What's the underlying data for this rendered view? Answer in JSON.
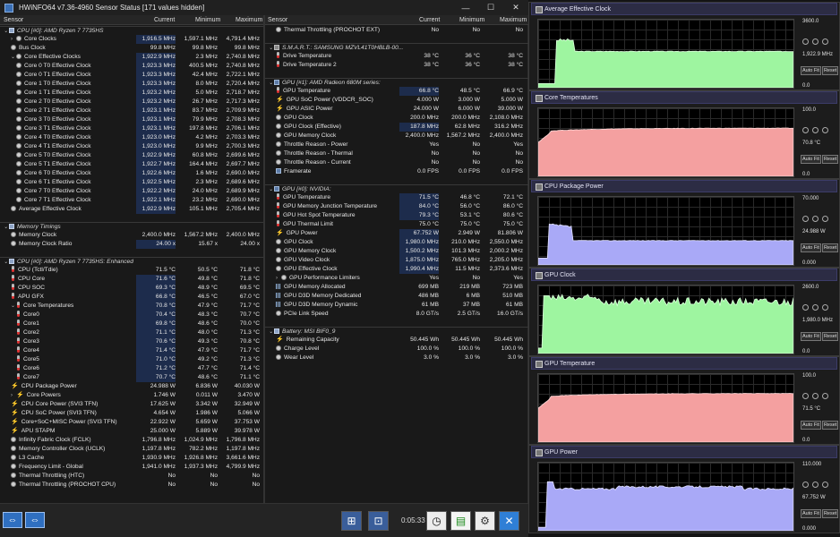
{
  "window": {
    "title": "HWiNFO64 v7.36-4960 Sensor Status [171 values hidden]",
    "min": "—",
    "max": "☐",
    "close": "✕"
  },
  "columns": {
    "sensor": "Sensor",
    "current": "Current",
    "minimum": "Minimum",
    "maximum": "Maximum"
  },
  "left_rows": [
    {
      "t": "g",
      "n": "CPU [#0]: AMD Ryzen 7 7735HS",
      "i": "chip",
      "e": "⌄"
    },
    {
      "n": "Core Clocks",
      "c": "1,916.5 MHz",
      "mi": "1,597.1 MHz",
      "ma": "4,791.4 MHz",
      "i": "circle",
      "e": "›",
      "d": 1,
      "h": 1
    },
    {
      "n": "Bus Clock",
      "c": "99.8 MHz",
      "mi": "99.8 MHz",
      "ma": "99.8 MHz",
      "i": "circle",
      "d": 1
    },
    {
      "n": "Core Effective Clocks",
      "c": "1,922.9 MHz",
      "mi": "2.3 MHz",
      "ma": "2,740.8 MHz",
      "i": "circle",
      "e": "⌄",
      "d": 1,
      "h": 1
    },
    {
      "n": "Core 0 T0 Effective Clock",
      "c": "1,923.3 MHz",
      "mi": "400.5 MHz",
      "ma": "2,740.8 MHz",
      "i": "circle",
      "d": 2,
      "h": 1
    },
    {
      "n": "Core 0 T1 Effective Clock",
      "c": "1,923.3 MHz",
      "mi": "42.4 MHz",
      "ma": "2,722.1 MHz",
      "i": "circle",
      "d": 2,
      "h": 1
    },
    {
      "n": "Core 1 T0 Effective Clock",
      "c": "1,923.3 MHz",
      "mi": "8.0 MHz",
      "ma": "2,720.4 MHz",
      "i": "circle",
      "d": 2,
      "h": 1
    },
    {
      "n": "Core 1 T1 Effective Clock",
      "c": "1,923.2 MHz",
      "mi": "5.0 MHz",
      "ma": "2,718.7 MHz",
      "i": "circle",
      "d": 2,
      "h": 1
    },
    {
      "n": "Core 2 T0 Effective Clock",
      "c": "1,923.2 MHz",
      "mi": "26.7 MHz",
      "ma": "2,717.3 MHz",
      "i": "circle",
      "d": 2,
      "h": 1
    },
    {
      "n": "Core 2 T1 Effective Clock",
      "c": "1,923.1 MHz",
      "mi": "83.7 MHz",
      "ma": "2,709.9 MHz",
      "i": "circle",
      "d": 2,
      "h": 1
    },
    {
      "n": "Core 3 T0 Effective Clock",
      "c": "1,923.1 MHz",
      "mi": "79.9 MHz",
      "ma": "2,708.3 MHz",
      "i": "circle",
      "d": 2,
      "h": 1
    },
    {
      "n": "Core 3 T1 Effective Clock",
      "c": "1,923.1 MHz",
      "mi": "197.8 MHz",
      "ma": "2,706.1 MHz",
      "i": "circle",
      "d": 2,
      "h": 1
    },
    {
      "n": "Core 4 T0 Effective Clock",
      "c": "1,923.0 MHz",
      "mi": "4.2 MHz",
      "ma": "2,703.3 MHz",
      "i": "circle",
      "d": 2,
      "h": 1
    },
    {
      "n": "Core 4 T1 Effective Clock",
      "c": "1,923.0 MHz",
      "mi": "9.9 MHz",
      "ma": "2,700.3 MHz",
      "i": "circle",
      "d": 2,
      "h": 1
    },
    {
      "n": "Core 5 T0 Effective Clock",
      "c": "1,922.9 MHz",
      "mi": "60.8 MHz",
      "ma": "2,699.6 MHz",
      "i": "circle",
      "d": 2,
      "h": 1
    },
    {
      "n": "Core 5 T1 Effective Clock",
      "c": "1,922.7 MHz",
      "mi": "164.4 MHz",
      "ma": "2,697.7 MHz",
      "i": "circle",
      "d": 2,
      "h": 1
    },
    {
      "n": "Core 6 T0 Effective Clock",
      "c": "1,922.6 MHz",
      "mi": "1.6 MHz",
      "ma": "2,690.0 MHz",
      "i": "circle",
      "d": 2,
      "h": 1
    },
    {
      "n": "Core 6 T1 Effective Clock",
      "c": "1,922.5 MHz",
      "mi": "2.3 MHz",
      "ma": "2,689.6 MHz",
      "i": "circle",
      "d": 2,
      "h": 1
    },
    {
      "n": "Core 7 T0 Effective Clock",
      "c": "1,922.2 MHz",
      "mi": "24.0 MHz",
      "ma": "2,689.9 MHz",
      "i": "circle",
      "d": 2,
      "h": 1
    },
    {
      "n": "Core 7 T1 Effective Clock",
      "c": "1,922.1 MHz",
      "mi": "23.2 MHz",
      "ma": "2,690.0 MHz",
      "i": "circle",
      "d": 2,
      "h": 1
    },
    {
      "n": "Average Effective Clock",
      "c": "1,922.9 MHz",
      "mi": "105.1 MHz",
      "ma": "2,705.4 MHz",
      "i": "circle",
      "d": 1,
      "h": 1
    },
    {
      "t": "s"
    },
    {
      "t": "g",
      "n": "Memory Timings",
      "i": "chip",
      "e": "⌄"
    },
    {
      "n": "Memory Clock",
      "c": "2,400.0 MHz",
      "mi": "1,567.2 MHz",
      "ma": "2,400.0 MHz",
      "i": "circle",
      "d": 1
    },
    {
      "n": "Memory Clock Ratio",
      "c": "24.00 x",
      "mi": "15.67 x",
      "ma": "24.00 x",
      "i": "circle",
      "d": 1,
      "h": 1
    },
    {
      "t": "s"
    },
    {
      "t": "g",
      "n": "CPU [#0]: AMD Ryzen 7 7735HS: Enhanced",
      "i": "chip",
      "e": "⌄"
    },
    {
      "n": "CPU (Tctl/Tdie)",
      "c": "71.5 °C",
      "mi": "50.5 °C",
      "ma": "71.8 °C",
      "i": "therm",
      "d": 1
    },
    {
      "n": "CPU Core",
      "c": "71.6 °C",
      "mi": "49.8 °C",
      "ma": "71.8 °C",
      "i": "therm",
      "d": 1,
      "h": 1
    },
    {
      "n": "CPU SOC",
      "c": "69.3 °C",
      "mi": "48.9 °C",
      "ma": "69.5 °C",
      "i": "therm",
      "d": 1,
      "h": 1
    },
    {
      "n": "APU GFX",
      "c": "66.8 °C",
      "mi": "46.5 °C",
      "ma": "67.0 °C",
      "i": "therm",
      "d": 1,
      "h": 1
    },
    {
      "n": "Core Temperatures",
      "c": "70.8 °C",
      "mi": "47.9 °C",
      "ma": "71.7 °C",
      "i": "therm",
      "e": "⌄",
      "d": 1,
      "h": 1
    },
    {
      "n": "Core0",
      "c": "70.4 °C",
      "mi": "48.3 °C",
      "ma": "70.7 °C",
      "i": "therm",
      "d": 2,
      "h": 1
    },
    {
      "n": "Core1",
      "c": "69.8 °C",
      "mi": "48.6 °C",
      "ma": "70.0 °C",
      "i": "therm",
      "d": 2,
      "h": 1
    },
    {
      "n": "Core2",
      "c": "71.1 °C",
      "mi": "48.0 °C",
      "ma": "71.3 °C",
      "i": "therm",
      "d": 2,
      "h": 1
    },
    {
      "n": "Core3",
      "c": "70.6 °C",
      "mi": "49.3 °C",
      "ma": "70.8 °C",
      "i": "therm",
      "d": 2,
      "h": 1
    },
    {
      "n": "Core4",
      "c": "71.4 °C",
      "mi": "47.9 °C",
      "ma": "71.7 °C",
      "i": "therm",
      "d": 2,
      "h": 1
    },
    {
      "n": "Core5",
      "c": "71.0 °C",
      "mi": "49.2 °C",
      "ma": "71.3 °C",
      "i": "therm",
      "d": 2,
      "h": 1
    },
    {
      "n": "Core6",
      "c": "71.2 °C",
      "mi": "47.7 °C",
      "ma": "71.4 °C",
      "i": "therm",
      "d": 2,
      "h": 1
    },
    {
      "n": "Core7",
      "c": "70.7 °C",
      "mi": "48.6 °C",
      "ma": "71.1 °C",
      "i": "therm",
      "d": 2,
      "h": 1
    },
    {
      "n": "CPU Package Power",
      "c": "24.988 W",
      "mi": "6.836 W",
      "ma": "40.030 W",
      "i": "bolt",
      "d": 1
    },
    {
      "n": "Core Powers",
      "c": "1.746 W",
      "mi": "0.011 W",
      "ma": "3.470 W",
      "i": "bolt",
      "e": "›",
      "d": 1
    },
    {
      "n": "CPU Core Power (SVI3 TFN)",
      "c": "17.625 W",
      "mi": "3.342 W",
      "ma": "32.949 W",
      "i": "bolt",
      "d": 1
    },
    {
      "n": "CPU SoC Power (SVI3 TFN)",
      "c": "4.654 W",
      "mi": "1.986 W",
      "ma": "5.066 W",
      "i": "bolt",
      "d": 1
    },
    {
      "n": "Core+SoC+MISC Power (SVI3 TFN)",
      "c": "22.922 W",
      "mi": "5.659 W",
      "ma": "37.753 W",
      "i": "bolt",
      "d": 1
    },
    {
      "n": "APU STAPM",
      "c": "25.000 W",
      "mi": "5.889 W",
      "ma": "39.978 W",
      "i": "bolt",
      "d": 1
    },
    {
      "n": "Infinity Fabric Clock (FCLK)",
      "c": "1,796.8 MHz",
      "mi": "1,024.9 MHz",
      "ma": "1,796.8 MHz",
      "i": "circle",
      "d": 1
    },
    {
      "n": "Memory Controller Clock (UCLK)",
      "c": "1,197.8 MHz",
      "mi": "782.2 MHz",
      "ma": "1,197.8 MHz",
      "i": "circle",
      "d": 1
    },
    {
      "n": "L3 Cache",
      "c": "1,930.9 MHz",
      "mi": "1,926.8 MHz",
      "ma": "3,661.6 MHz",
      "i": "circle",
      "d": 1
    },
    {
      "n": "Frequency Limit - Global",
      "c": "1,941.0 MHz",
      "mi": "1,937.3 MHz",
      "ma": "4,799.9 MHz",
      "i": "circle",
      "d": 1
    },
    {
      "n": "Thermal Throttling (HTC)",
      "c": "No",
      "mi": "No",
      "ma": "No",
      "i": "circle",
      "d": 1
    },
    {
      "n": "Thermal Throttling (PROCHOT CPU)",
      "c": "No",
      "mi": "No",
      "ma": "No",
      "i": "circle",
      "d": 1
    }
  ],
  "right_rows": [
    {
      "n": "Thermal Throttling (PROCHOT EXT)",
      "c": "No",
      "mi": "No",
      "ma": "No",
      "i": "circle",
      "d": 1
    },
    {
      "t": "s"
    },
    {
      "t": "g",
      "n": "S.M.A.R.T.: SAMSUNG MZVL41T0HBLB-00...",
      "i": "hdd",
      "e": "⌄"
    },
    {
      "n": "Drive Temperature",
      "c": "38 °C",
      "mi": "36 °C",
      "ma": "38 °C",
      "i": "therm",
      "d": 1
    },
    {
      "n": "Drive Temperature 2",
      "c": "38 °C",
      "mi": "36 °C",
      "ma": "38 °C",
      "i": "therm",
      "d": 1
    },
    {
      "t": "s"
    },
    {
      "t": "g",
      "n": "GPU [#1]: AMD Radeon 680M series:",
      "i": "mon",
      "e": "⌄"
    },
    {
      "n": "GPU Temperature",
      "c": "66.8 °C",
      "mi": "48.5 °C",
      "ma": "66.9 °C",
      "i": "therm",
      "d": 1,
      "h": 1
    },
    {
      "n": "GPU SoC Power (VDDCR_SOC)",
      "c": "4.000 W",
      "mi": "3.000 W",
      "ma": "5.000 W",
      "i": "bolt",
      "d": 1
    },
    {
      "n": "GPU ASIC Power",
      "c": "24.000 W",
      "mi": "6.000 W",
      "ma": "39.000 W",
      "i": "bolt",
      "d": 1
    },
    {
      "n": "GPU Clock",
      "c": "200.0 MHz",
      "mi": "200.0 MHz",
      "ma": "2,108.0 MHz",
      "i": "circle",
      "d": 1
    },
    {
      "n": "GPU Clock (Effective)",
      "c": "187.8 MHz",
      "mi": "62.8 MHz",
      "ma": "316.2 MHz",
      "i": "circle",
      "d": 1,
      "h": 1
    },
    {
      "n": "GPU Memory Clock",
      "c": "2,400.0 MHz",
      "mi": "1,567.2 MHz",
      "ma": "2,400.0 MHz",
      "i": "circle",
      "d": 1
    },
    {
      "n": "Throttle Reason - Power",
      "c": "Yes",
      "mi": "No",
      "ma": "Yes",
      "i": "circle",
      "d": 1
    },
    {
      "n": "Throttle Reason - Thermal",
      "c": "No",
      "mi": "No",
      "ma": "No",
      "i": "circle",
      "d": 1
    },
    {
      "n": "Throttle Reason - Current",
      "c": "No",
      "mi": "No",
      "ma": "No",
      "i": "circle",
      "d": 1
    },
    {
      "n": "Framerate",
      "c": "0.0 FPS",
      "mi": "0.0 FPS",
      "ma": "0.0 FPS",
      "i": "mon",
      "d": 1
    },
    {
      "t": "s"
    },
    {
      "t": "g",
      "n": "GPU [#0]: NVIDIA:",
      "i": "mon",
      "e": "⌄"
    },
    {
      "n": "GPU Temperature",
      "c": "71.5 °C",
      "mi": "46.8 °C",
      "ma": "72.1 °C",
      "i": "therm",
      "d": 1,
      "h": 1
    },
    {
      "n": "GPU Memory Junction Temperature",
      "c": "84.0 °C",
      "mi": "56.0 °C",
      "ma": "86.0 °C",
      "i": "therm",
      "d": 1,
      "h": 1
    },
    {
      "n": "GPU Hot Spot Temperature",
      "c": "79.3 °C",
      "mi": "53.1 °C",
      "ma": "80.6 °C",
      "i": "therm",
      "d": 1,
      "h": 1
    },
    {
      "n": "GPU Thermal Limit",
      "c": "75.0 °C",
      "mi": "75.0 °C",
      "ma": "75.0 °C",
      "i": "therm",
      "d": 1
    },
    {
      "n": "GPU Power",
      "c": "67.752 W",
      "mi": "2.949 W",
      "ma": "81.806 W",
      "i": "bolt",
      "d": 1,
      "h": 1
    },
    {
      "n": "GPU Clock",
      "c": "1,980.0 MHz",
      "mi": "210.0 MHz",
      "ma": "2,550.0 MHz",
      "i": "circle",
      "d": 1,
      "h": 1
    },
    {
      "n": "GPU Memory Clock",
      "c": "1,500.2 MHz",
      "mi": "101.3 MHz",
      "ma": "2,000.2 MHz",
      "i": "circle",
      "d": 1,
      "h": 1
    },
    {
      "n": "GPU Video Clock",
      "c": "1,875.0 MHz",
      "mi": "765.0 MHz",
      "ma": "2,205.0 MHz",
      "i": "circle",
      "d": 1,
      "h": 1
    },
    {
      "n": "GPU Effective Clock",
      "c": "1,990.4 MHz",
      "mi": "11.5 MHz",
      "ma": "2,373.6 MHz",
      "i": "circle",
      "d": 1,
      "h": 1
    },
    {
      "n": "GPU Performance Limiters",
      "c": "Yes",
      "mi": "No",
      "ma": "Yes",
      "i": "circle",
      "e": "›",
      "d": 1
    },
    {
      "n": "GPU Memory Allocated",
      "c": "699 MB",
      "mi": "219 MB",
      "ma": "723 MB",
      "i": "bar",
      "d": 1
    },
    {
      "n": "GPU D3D Memory Dedicated",
      "c": "486 MB",
      "mi": "6 MB",
      "ma": "510 MB",
      "i": "bar",
      "d": 1
    },
    {
      "n": "GPU D3D Memory Dynamic",
      "c": "61 MB",
      "mi": "37 MB",
      "ma": "61 MB",
      "i": "bar",
      "d": 1
    },
    {
      "n": "PCIe Link Speed",
      "c": "8.0 GT/s",
      "mi": "2.5 GT/s",
      "ma": "16.0 GT/s",
      "i": "circle",
      "d": 1
    },
    {
      "t": "s"
    },
    {
      "t": "g",
      "n": "Battery: MSI BIF0_9",
      "i": "chip",
      "e": "⌄"
    },
    {
      "n": "Remaining Capacity",
      "c": "50.445 Wh",
      "mi": "50.445 Wh",
      "ma": "50.445 Wh",
      "i": "bolt",
      "d": 1
    },
    {
      "n": "Charge Level",
      "c": "100.0 %",
      "mi": "100.0 %",
      "ma": "100.0 %",
      "i": "circle",
      "d": 1
    },
    {
      "n": "Wear Level",
      "c": "3.0 %",
      "mi": "3.0 %",
      "ma": "3.0 %",
      "i": "circle",
      "d": 1
    }
  ],
  "bottom": {
    "timer": "0:05:33",
    "nav_left": "⇔",
    "nav_right": "⇔",
    "btn_net": "⊞",
    "btn_mon": "⊡",
    "btn_clock": "◷",
    "btn_report": "▤",
    "btn_settings": "⚙",
    "btn_close": "✕"
  },
  "graphs": [
    {
      "title": "Average Effective Clock",
      "max": "3600.0",
      "cur": "1,922.9 MHz",
      "min": "0.0",
      "fill": "#9ef5a0",
      "stroke": "#dcffdc",
      "level": 0.534,
      "shape": "clock"
    },
    {
      "title": "Core Temperatures",
      "max": "100.0",
      "cur": "70.8 °C",
      "min": "0.0",
      "fill": "#f4a0a0",
      "stroke": "#ffdada",
      "level": 0.708,
      "shape": "temp"
    },
    {
      "title": "CPU Package Power",
      "max": "70.000",
      "cur": "24.988 W",
      "min": "0.000",
      "fill": "#a9a9f7",
      "stroke": "#e0e0ff",
      "level": 0.357,
      "shape": "power"
    },
    {
      "title": "GPU Clock",
      "max": "2600.0",
      "cur": "1,980.0 MHz",
      "min": "0.0",
      "fill": "#9ef5a0",
      "stroke": "#dcffdc",
      "level": 0.762,
      "shape": "gclock"
    },
    {
      "title": "GPU Temperature",
      "max": "100.0",
      "cur": "71.5 °C",
      "min": "0.0",
      "fill": "#f4a0a0",
      "stroke": "#ffdada",
      "level": 0.715,
      "shape": "temp"
    },
    {
      "title": "GPU Power",
      "max": "110.000",
      "cur": "67.752 W",
      "min": "0.000",
      "fill": "#a9a9f7",
      "stroke": "#e0e0ff",
      "level": 0.616,
      "shape": "gpower"
    }
  ],
  "graph_buttons": {
    "autofit": "Auto Fit",
    "reset": "Reset"
  }
}
